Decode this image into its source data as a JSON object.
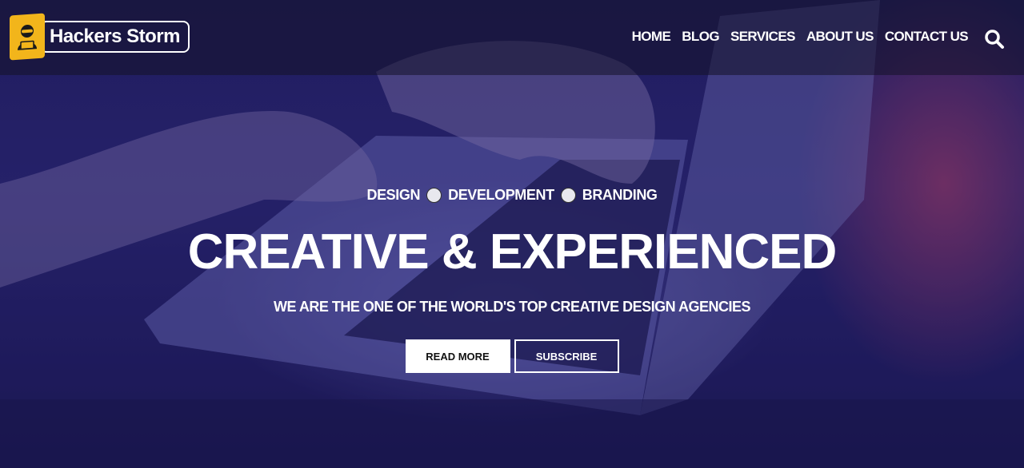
{
  "header": {
    "logo_text": "Hackers Storm",
    "nav": [
      "HOME",
      "BLOG",
      "SERVICES",
      "ABOUT US",
      "CONTACT US"
    ]
  },
  "hero": {
    "tagline": [
      "DESIGN",
      "DEVELOPMENT",
      "BRANDING"
    ],
    "headline": "CREATIVE & EXPERIENCED",
    "subline": "WE ARE THE ONE OF THE WORLD'S TOP CREATIVE DESIGN AGENCIES",
    "buttons": {
      "read_more": "READ MORE",
      "subscribe": "SUBSCRIBE"
    }
  },
  "colors": {
    "logo_accent": "#f2b51b",
    "overlay": "#1c186e",
    "text": "#ffffff"
  },
  "icons": {
    "search": "search-icon",
    "logo": "hacker-logo-icon"
  }
}
